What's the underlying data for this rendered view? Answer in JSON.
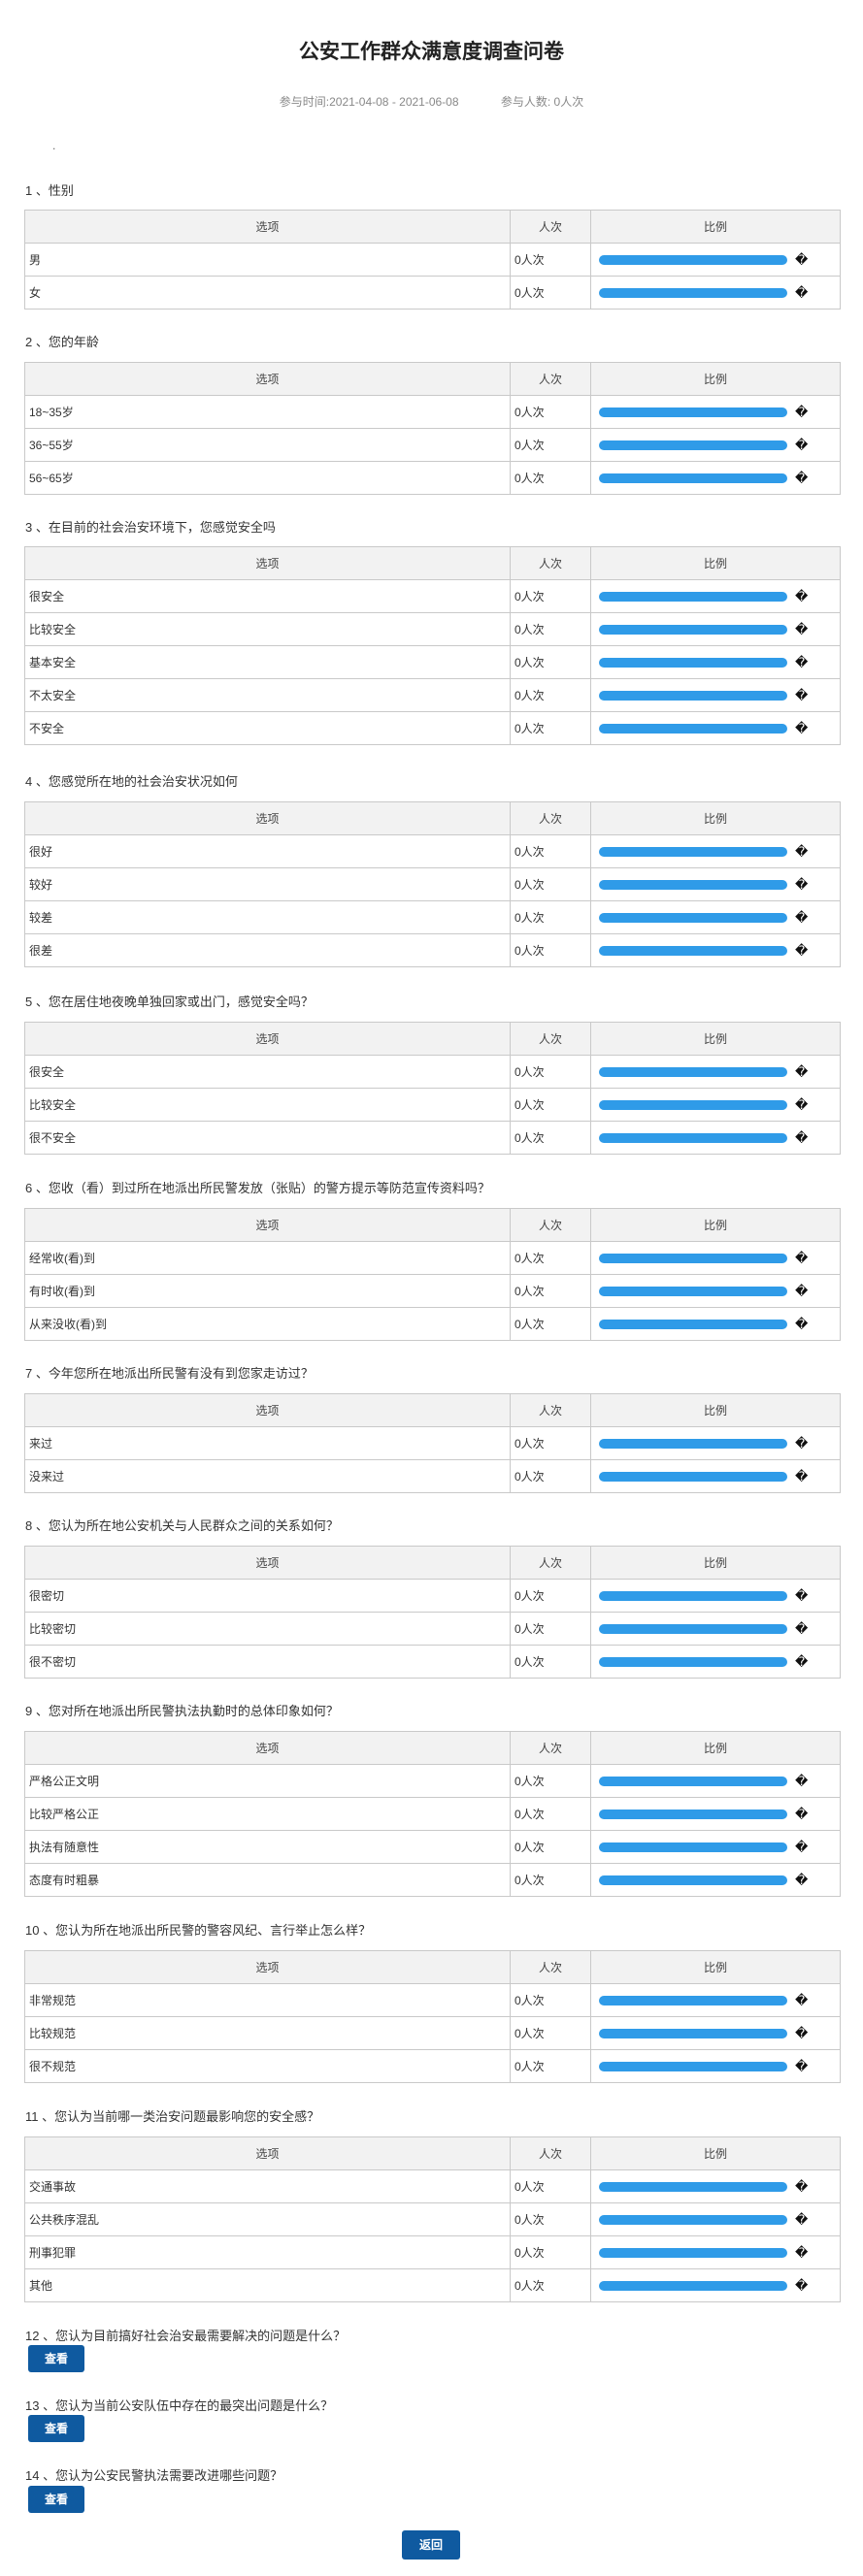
{
  "title": "公安工作群众满意度调查问卷",
  "meta": {
    "time": "参与时间:2021-04-08 - 2021-06-08",
    "people": "参与人数: 0人次"
  },
  "dot": ".",
  "table_headers": {
    "option": "选项",
    "count": "人次",
    "ratio": "比例"
  },
  "ratio_glyph": "�",
  "bar_color": "#2f9be8",
  "questions": [
    {
      "title": "1 、性别",
      "options": [
        {
          "label": "男",
          "count": "0人次"
        },
        {
          "label": "女",
          "count": "0人次"
        }
      ]
    },
    {
      "title": "2 、您的年龄",
      "options": [
        {
          "label": "18~35岁",
          "count": "0人次"
        },
        {
          "label": "36~55岁",
          "count": "0人次"
        },
        {
          "label": "56~65岁",
          "count": "0人次"
        }
      ]
    },
    {
      "title": "3 、在目前的社会治安环境下，您感觉安全吗",
      "options": [
        {
          "label": "很安全",
          "count": "0人次"
        },
        {
          "label": "比较安全",
          "count": "0人次"
        },
        {
          "label": "基本安全",
          "count": "0人次"
        },
        {
          "label": "不太安全",
          "count": "0人次"
        },
        {
          "label": "不安全",
          "count": "0人次"
        }
      ]
    },
    {
      "title": "4 、您感觉所在地的社会治安状况如何",
      "options": [
        {
          "label": "很好",
          "count": "0人次"
        },
        {
          "label": "较好",
          "count": "0人次"
        },
        {
          "label": "较差",
          "count": "0人次"
        },
        {
          "label": "很差",
          "count": "0人次"
        }
      ]
    },
    {
      "title": "5 、您在居住地夜晚单独回家或出门，感觉安全吗？",
      "options": [
        {
          "label": "很安全",
          "count": "0人次"
        },
        {
          "label": "比较安全",
          "count": "0人次"
        },
        {
          "label": "很不安全",
          "count": "0人次"
        }
      ]
    },
    {
      "title": "6 、您收（看）到过所在地派出所民警发放（张贴）的警方提示等防范宣传资料吗？",
      "options": [
        {
          "label": "经常收(看)到",
          "count": "0人次"
        },
        {
          "label": "有时收(看)到",
          "count": "0人次"
        },
        {
          "label": "从来没收(看)到",
          "count": "0人次"
        }
      ]
    },
    {
      "title": "7 、今年您所在地派出所民警有没有到您家走访过？",
      "options": [
        {
          "label": "来过",
          "count": "0人次"
        },
        {
          "label": "没来过",
          "count": "0人次"
        }
      ]
    },
    {
      "title": "8 、您认为所在地公安机关与人民群众之间的关系如何？",
      "options": [
        {
          "label": "很密切",
          "count": "0人次"
        },
        {
          "label": "比较密切",
          "count": "0人次"
        },
        {
          "label": "很不密切",
          "count": "0人次"
        }
      ]
    },
    {
      "title": "9 、您对所在地派出所民警执法执勤时的总体印象如何？",
      "options": [
        {
          "label": "严格公正文明",
          "count": "0人次"
        },
        {
          "label": "比较严格公正",
          "count": "0人次"
        },
        {
          "label": "执法有随意性",
          "count": "0人次"
        },
        {
          "label": "态度有时粗暴",
          "count": "0人次"
        }
      ]
    },
    {
      "title": "10 、您认为所在地派出所民警的警容风纪、言行举止怎么样？",
      "options": [
        {
          "label": "非常规范",
          "count": "0人次"
        },
        {
          "label": "比较规范",
          "count": "0人次"
        },
        {
          "label": "很不规范",
          "count": "0人次"
        }
      ]
    },
    {
      "title": "11 、您认为当前哪一类治安问题最影响您的安全感？",
      "options": [
        {
          "label": "交通事故",
          "count": "0人次"
        },
        {
          "label": "公共秩序混乱",
          "count": "0人次"
        },
        {
          "label": "刑事犯罪",
          "count": "0人次"
        },
        {
          "label": "其他",
          "count": "0人次"
        }
      ]
    }
  ],
  "text_questions": [
    {
      "title": "12 、您认为目前搞好社会治安最需要解决的问题是什么？",
      "button": "查看"
    },
    {
      "title": "13 、您认为当前公安队伍中存在的最突出问题是什么？",
      "button": "查看"
    },
    {
      "title": "14 、您认为公安民警执法需要改进哪些问题？",
      "button": "查看"
    }
  ],
  "back_button": "返回"
}
